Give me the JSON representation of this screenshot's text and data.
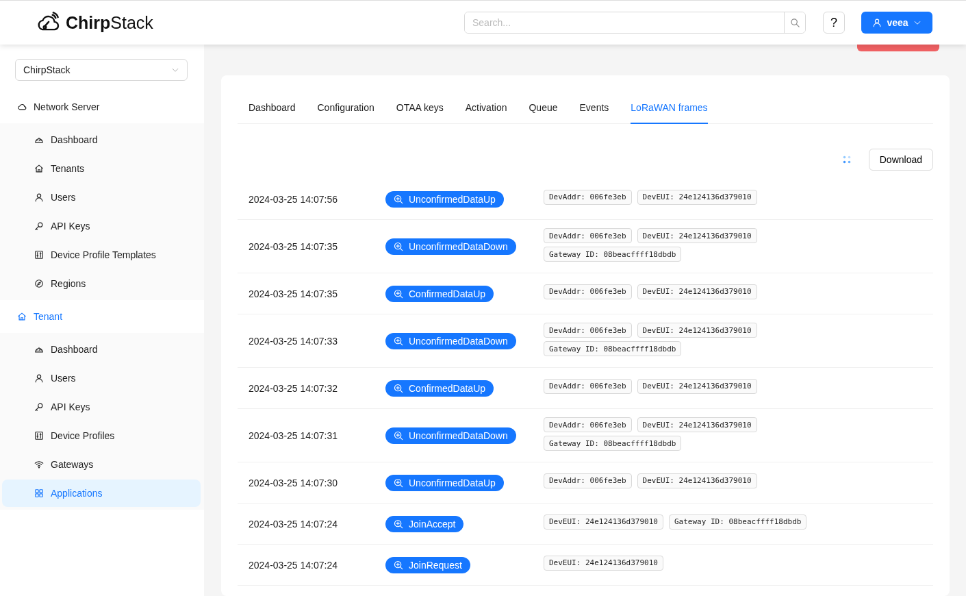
{
  "header": {
    "logo": "**Chirp**Stack",
    "search": {
      "placeholder": "Search..."
    },
    "help": "?",
    "user": "veea"
  },
  "sidebar": {
    "tenant_select": "ChirpStack",
    "sections": [
      {
        "title": "Network Server",
        "kind": "cloud",
        "active": false,
        "items": [
          {
            "label": "Dashboard",
            "kind": "dashboard",
            "selected": false
          },
          {
            "label": "Tenants",
            "kind": "home",
            "selected": false
          },
          {
            "label": "Users",
            "kind": "user",
            "selected": false
          },
          {
            "label": "API Keys",
            "kind": "key",
            "selected": false
          },
          {
            "label": "Device Profile Templates",
            "kind": "sliders",
            "selected": false
          },
          {
            "label": "Regions",
            "kind": "compass",
            "selected": false
          }
        ]
      },
      {
        "title": "Tenant",
        "kind": "home",
        "active": true,
        "items": [
          {
            "label": "Dashboard",
            "kind": "dashboard",
            "selected": false
          },
          {
            "label": "Users",
            "kind": "user",
            "selected": false
          },
          {
            "label": "API Keys",
            "kind": "key",
            "selected": false
          },
          {
            "label": "Device Profiles",
            "kind": "sliders",
            "selected": false
          },
          {
            "label": "Gateways",
            "kind": "wifi",
            "selected": false
          },
          {
            "label": "Applications",
            "kind": "apps",
            "selected": true
          }
        ]
      }
    ]
  },
  "tabs": [
    {
      "label": "Dashboard",
      "selected": false
    },
    {
      "label": "Configuration",
      "selected": false
    },
    {
      "label": "OTAA keys",
      "selected": false
    },
    {
      "label": "Activation",
      "selected": false
    },
    {
      "label": "Queue",
      "selected": false
    },
    {
      "label": "Events",
      "selected": false
    },
    {
      "label": "LoRaWAN frames",
      "selected": true
    }
  ],
  "download_button": "Download",
  "frames": [
    {
      "time": "2024-03-25 14:07:56",
      "type": "UnconfirmedDataUp",
      "tags": [
        "DevAddr: 006fe3eb",
        "DevEUI: 24e124136d379010"
      ]
    },
    {
      "time": "2024-03-25 14:07:35",
      "type": "UnconfirmedDataDown",
      "tags": [
        "DevAddr: 006fe3eb",
        "DevEUI: 24e124136d379010",
        "Gateway ID: 08beacffff18dbdb"
      ]
    },
    {
      "time": "2024-03-25 14:07:35",
      "type": "ConfirmedDataUp",
      "tags": [
        "DevAddr: 006fe3eb",
        "DevEUI: 24e124136d379010"
      ]
    },
    {
      "time": "2024-03-25 14:07:33",
      "type": "UnconfirmedDataDown",
      "tags": [
        "DevAddr: 006fe3eb",
        "DevEUI: 24e124136d379010",
        "Gateway ID: 08beacffff18dbdb"
      ]
    },
    {
      "time": "2024-03-25 14:07:32",
      "type": "ConfirmedDataUp",
      "tags": [
        "DevAddr: 006fe3eb",
        "DevEUI: 24e124136d379010"
      ]
    },
    {
      "time": "2024-03-25 14:07:31",
      "type": "UnconfirmedDataDown",
      "tags": [
        "DevAddr: 006fe3eb",
        "DevEUI: 24e124136d379010",
        "Gateway ID: 08beacffff18dbdb"
      ]
    },
    {
      "time": "2024-03-25 14:07:30",
      "type": "UnconfirmedDataUp",
      "tags": [
        "DevAddr: 006fe3eb",
        "DevEUI: 24e124136d379010"
      ]
    },
    {
      "time": "2024-03-25 14:07:24",
      "type": "JoinAccept",
      "tags": [
        "DevEUI: 24e124136d379010",
        "Gateway ID: 08beacffff18dbdb"
      ]
    },
    {
      "time": "2024-03-25 14:07:24",
      "type": "JoinRequest",
      "tags": [
        "DevEUI: 24e124136d379010"
      ]
    }
  ]
}
